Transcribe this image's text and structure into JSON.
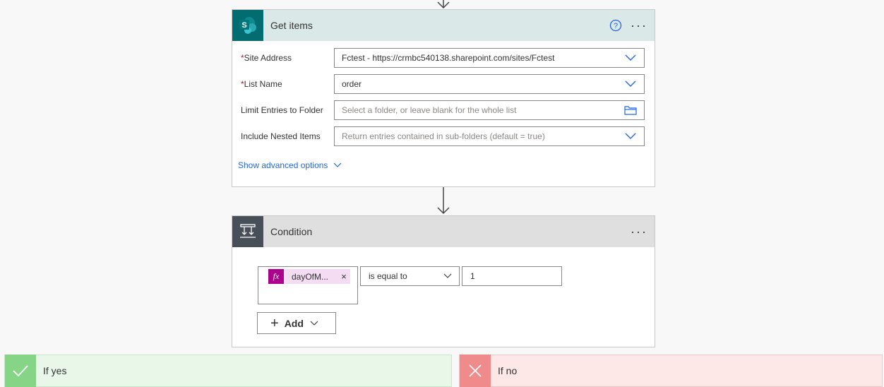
{
  "get_items": {
    "title": "Get items",
    "icon": "sharepoint-icon",
    "icon_letter": "S",
    "fields": [
      {
        "label": "Site Address",
        "required": true,
        "value": "Fctest - https://crmbc540138.sharepoint.com/sites/Fctest",
        "placeholder": "",
        "control": "dropdown"
      },
      {
        "label": "List Name",
        "required": true,
        "value": "order",
        "placeholder": "",
        "control": "dropdown"
      },
      {
        "label": "Limit Entries to Folder",
        "required": false,
        "value": "",
        "placeholder": "Select a folder, or leave blank for the whole list",
        "control": "folder-picker"
      },
      {
        "label": "Include Nested Items",
        "required": false,
        "value": "",
        "placeholder": "Return entries contained in sub-folders (default = true)",
        "control": "dropdown"
      }
    ],
    "required_mark": "*",
    "advanced_link": "Show advanced options"
  },
  "condition": {
    "title": "Condition",
    "icon": "condition-icon",
    "left_operand": {
      "token_icon": "fx",
      "token_text": "dayOfM...",
      "token_remove": "×"
    },
    "operator": "is equal to",
    "right_operand": "1",
    "add_button": "Add"
  },
  "branches": {
    "yes_label": "If yes",
    "no_label": "If no"
  },
  "colors": {
    "sharepoint": "#036c70",
    "link": "#2266e3",
    "required": "#a4262c",
    "yes": "#86d586",
    "no": "#f08b8b",
    "expression": "#ad008c"
  }
}
